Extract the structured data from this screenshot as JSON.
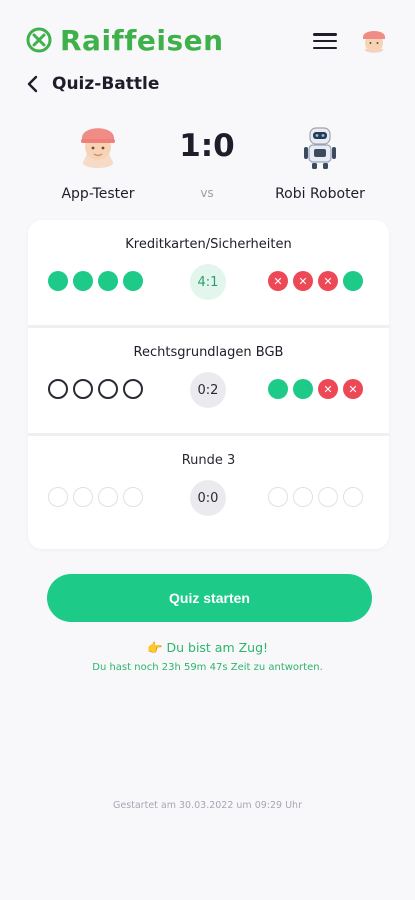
{
  "header": {
    "brand": "Raiffeisen",
    "brand_color": "#3fb14a",
    "menu_icon": "hamburger-menu-icon",
    "avatar_icon": "user-avatar-icon"
  },
  "nav": {
    "back_icon": "chevron-left-icon",
    "title": "Quiz-Battle"
  },
  "match": {
    "player1": {
      "name": "App-Tester",
      "avatar": "tester-avatar-icon"
    },
    "player2": {
      "name": "Robi Roboter",
      "avatar": "robot-avatar-icon"
    },
    "score": "1:0",
    "vs_label": "vs"
  },
  "rounds": [
    {
      "title": "Kreditkarten/Sicherheiten",
      "score": "4:1",
      "player1_answers": [
        "correct",
        "correct",
        "correct",
        "correct"
      ],
      "player2_answers": [
        "wrong",
        "wrong",
        "wrong",
        "correct"
      ]
    },
    {
      "title": "Rechtsgrundlagen BGB",
      "score": "0:2",
      "player1_answers": [
        "empty",
        "empty",
        "empty",
        "empty"
      ],
      "player2_answers": [
        "correct",
        "correct",
        "wrong",
        "wrong"
      ]
    },
    {
      "title": "Runde 3",
      "score": "0:0",
      "player1_answers": [
        "pending",
        "pending",
        "pending",
        "pending"
      ],
      "player2_answers": [
        "pending",
        "pending",
        "pending",
        "pending"
      ]
    }
  ],
  "actions": {
    "start_label": "Quiz starten"
  },
  "status": {
    "turn": "👉 Du bist am Zug!",
    "time_left": "Du hast noch 23h 59m 47s Zeit zu antworten.",
    "started": "Gestartet am 30.03.2022 um 09:29 Uhr"
  },
  "colors": {
    "correct": "#1dca87",
    "wrong": "#ec4856",
    "accent_green": "#2cb56c"
  }
}
